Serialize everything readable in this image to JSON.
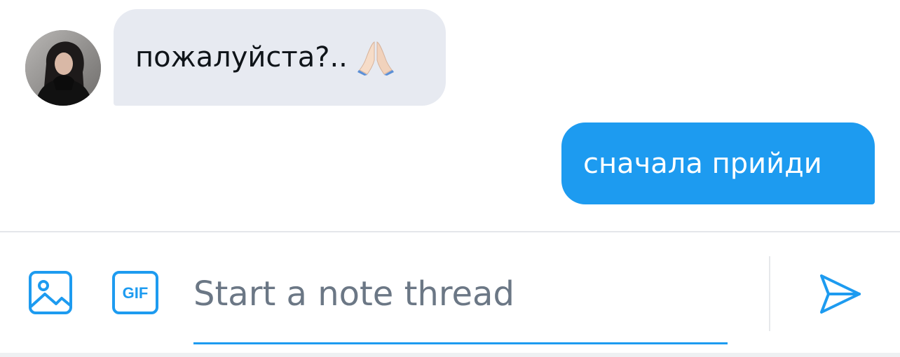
{
  "messages": [
    {
      "direction": "incoming",
      "text": "пожалуйста?..",
      "emoji": "🙏",
      "avatar_icon": "user-avatar"
    },
    {
      "direction": "outgoing",
      "text": "сначала прийди"
    }
  ],
  "composer": {
    "placeholder": "Start a note thread",
    "value": "",
    "media_icon": "image-icon",
    "gif_icon": "gif-icon",
    "gif_label": "GIF",
    "send_icon": "send-icon"
  },
  "colors": {
    "accent": "#1d9bf0",
    "incoming_bubble": "#e7eaf1",
    "outgoing_bubble": "#1d9bf0",
    "text_primary": "#0f1419",
    "placeholder": "#6b7785",
    "divider": "#e4e6ea"
  }
}
